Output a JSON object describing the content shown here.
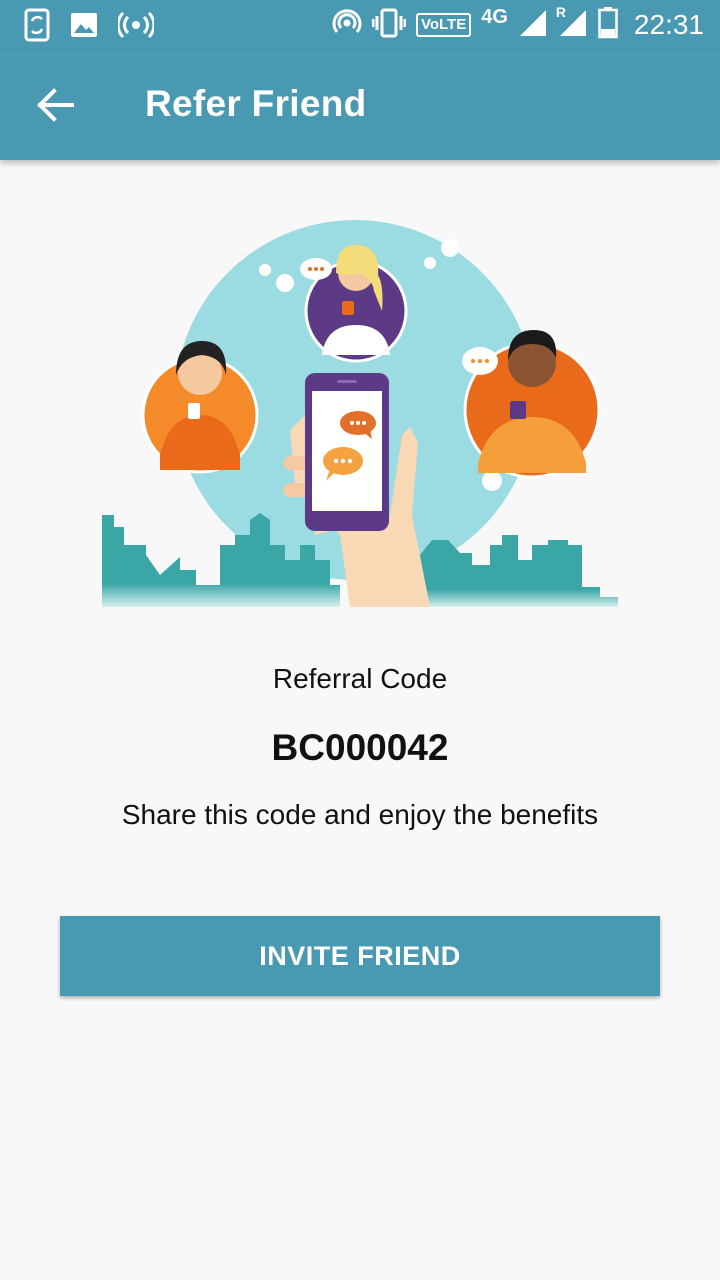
{
  "status_bar": {
    "time": "22:31",
    "network": "4G",
    "volte": "VoLTE",
    "roaming": "R",
    "icons": [
      "phone-sync-icon",
      "image-icon",
      "broadcast-icon",
      "hotspot-icon",
      "vibrate-icon",
      "signal-icon",
      "signal-roaming-icon",
      "battery-icon"
    ]
  },
  "app_bar": {
    "title": "Refer Friend",
    "back_icon": "arrow-back-icon"
  },
  "illustration": {
    "name": "refer-friends-illustration"
  },
  "referral": {
    "label": "Referral Code",
    "code": "BC000042",
    "description": "Share this code and enjoy the benefits"
  },
  "actions": {
    "invite_label": "INVITE FRIEND"
  },
  "colors": {
    "primary": "#4a99b3",
    "background": "#f8f8f8",
    "orange": "#f58a2b",
    "purple": "#5c3a86",
    "teal_city": "#3aa6a6"
  }
}
